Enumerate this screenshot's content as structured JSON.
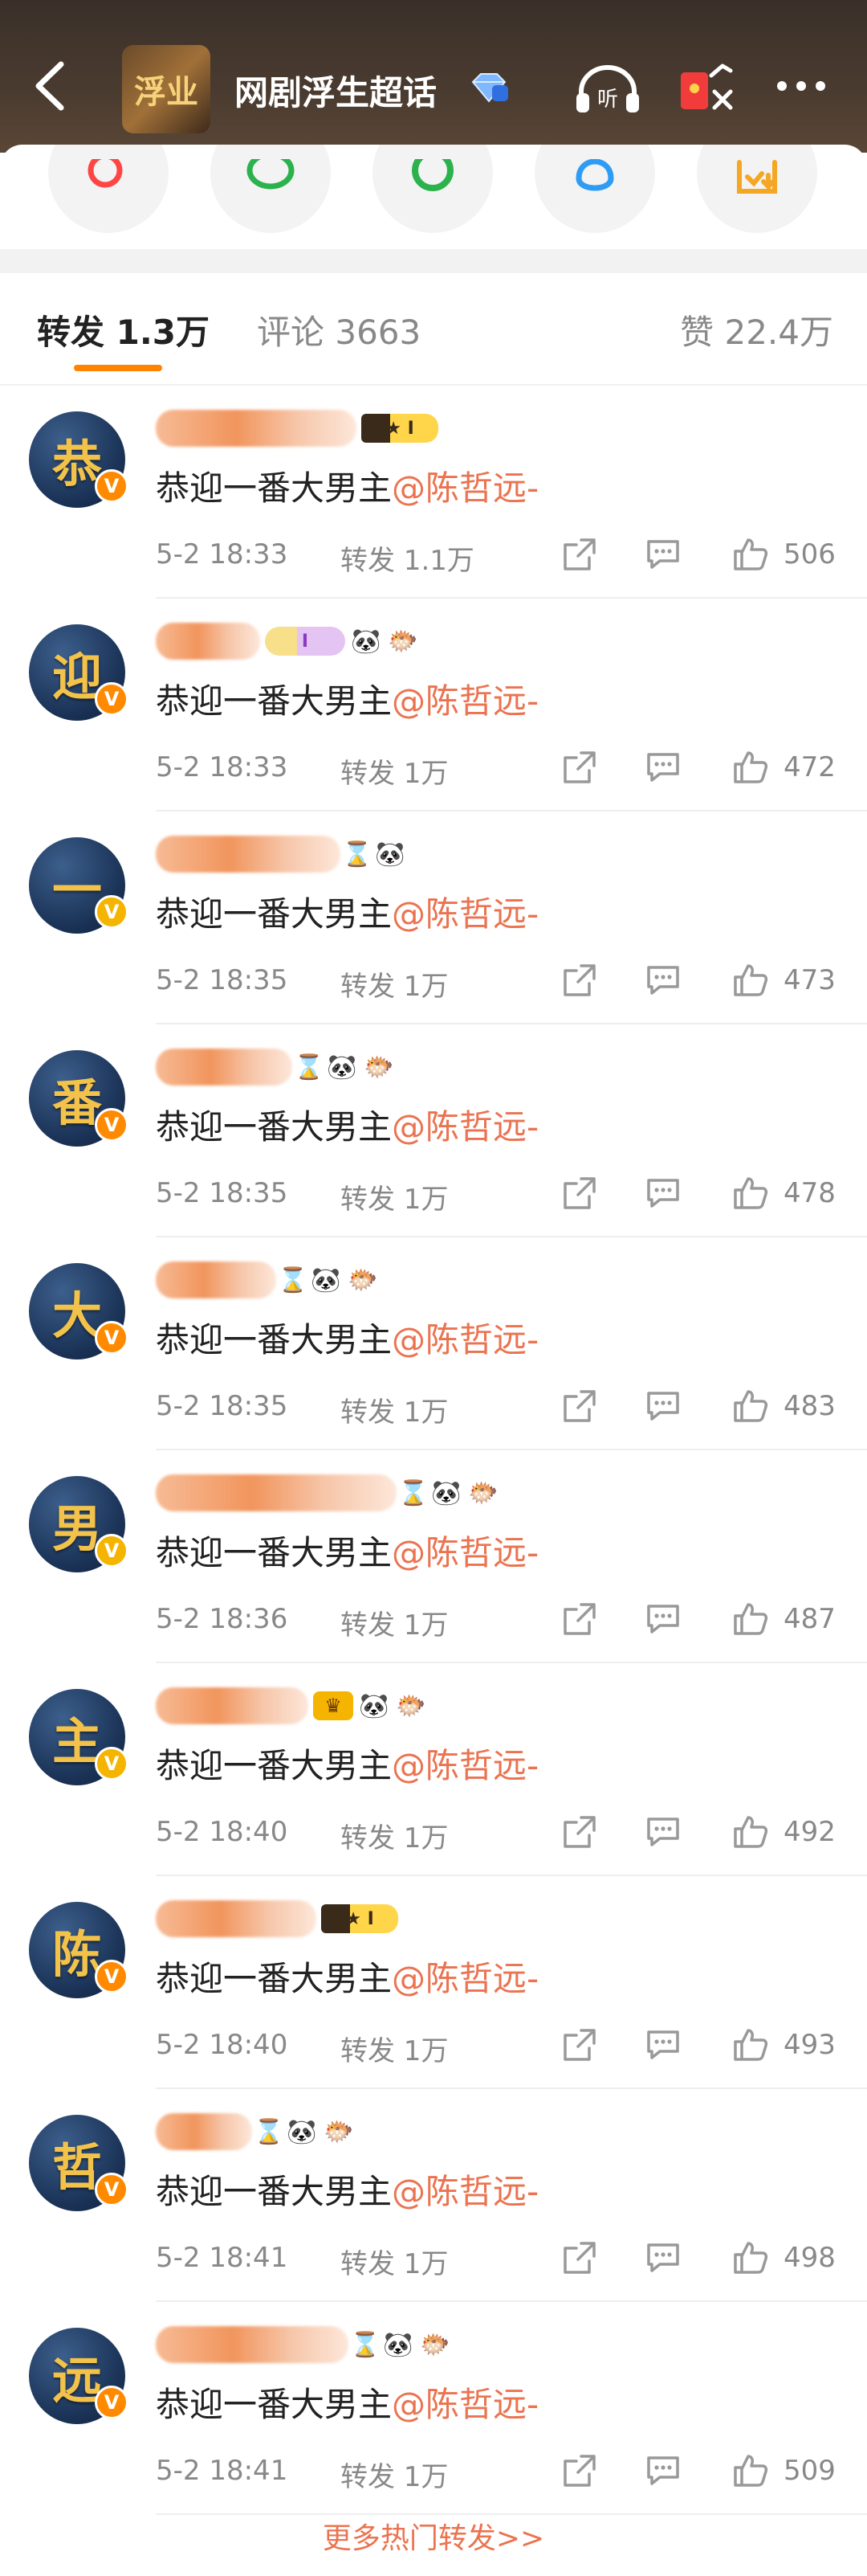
{
  "header": {
    "community_logo_text": "浮业",
    "title": "网剧浮生超话"
  },
  "share_icons": [
    "search-icon",
    "wechat-icon",
    "moments-icon",
    "qq-icon",
    "save-image-icon"
  ],
  "tabs": {
    "repost": "转发 1.3万",
    "comments": "评论 3663",
    "likes": "赞 22.4万"
  },
  "items": [
    {
      "avatar_char": "恭",
      "name_prefix": "边",
      "name_suffix": "",
      "badges": [
        "level"
      ],
      "content": "恭迎一番大男主",
      "mention": "@陈哲远-",
      "time": "5-2 18:33",
      "reposts": "转发 1.1万",
      "likes": "506"
    },
    {
      "avatar_char": "迎",
      "name_prefix": "",
      "name_suffix": "",
      "badges": [
        "purple",
        "panda",
        "fish"
      ],
      "content": "恭迎一番大男主",
      "mention": "@陈哲远-",
      "time": "5-2 18:33",
      "reposts": "转发 1万",
      "likes": "472"
    },
    {
      "avatar_char": "一",
      "name_prefix": "",
      "name_suffix": "",
      "badges": [
        "hourglass",
        "panda"
      ],
      "content": "恭迎一番大男主",
      "mention": "@陈哲远-",
      "time": "5-2 18:35",
      "reposts": "转发 1万",
      "likes": "473"
    },
    {
      "avatar_char": "番",
      "name_prefix": "",
      "name_suffix": "",
      "badges": [
        "hourglass",
        "panda",
        "fish"
      ],
      "content": "恭迎一番大男主",
      "mention": "@陈哲远-",
      "time": "5-2 18:35",
      "reposts": "转发 1万",
      "likes": "478"
    },
    {
      "avatar_char": "大",
      "name_prefix": "",
      "name_suffix": "",
      "badges": [
        "hourglass",
        "panda",
        "fish"
      ],
      "content": "恭迎一番大男主",
      "mention": "@陈哲远-",
      "time": "5-2 18:35",
      "reposts": "转发 1万",
      "likes": "483"
    },
    {
      "avatar_char": "男",
      "name_prefix": "",
      "name_suffix": "",
      "badges": [
        "hourglass",
        "panda",
        "fish"
      ],
      "content": "恭迎一番大男主",
      "mention": "@陈哲远-",
      "time": "5-2 18:36",
      "reposts": "转发 1万",
      "likes": "487"
    },
    {
      "avatar_char": "主",
      "name_prefix": "",
      "name_suffix": "",
      "badges": [
        "crown",
        "panda",
        "fish"
      ],
      "content": "恭迎一番大男主",
      "mention": "@陈哲远-",
      "time": "5-2 18:40",
      "reposts": "转发 1万",
      "likes": "492"
    },
    {
      "avatar_char": "陈",
      "name_prefix": "",
      "name_suffix": "",
      "badges": [
        "level"
      ],
      "content": "恭迎一番大男主",
      "mention": "@陈哲远-",
      "time": "5-2 18:40",
      "reposts": "转发 1万",
      "likes": "493"
    },
    {
      "avatar_char": "哲",
      "name_prefix": "",
      "name_suffix": "",
      "badges": [
        "hourglass",
        "panda",
        "fish"
      ],
      "content": "恭迎一番大男主",
      "mention": "@陈哲远-",
      "time": "5-2 18:41",
      "reposts": "转发 1万",
      "likes": "498"
    },
    {
      "avatar_char": "远",
      "name_prefix": "",
      "name_suffix": "",
      "badges": [
        "hourglass",
        "panda",
        "fish"
      ],
      "content": "恭迎一番大男主",
      "mention": "@陈哲远-",
      "time": "5-2 18:41",
      "reposts": "转发 1万",
      "likes": "509"
    }
  ],
  "footer": {
    "more_link": "更多热门转发>>"
  },
  "colors": {
    "accent": "#ff8200",
    "mention": "#eb7350",
    "meta_text": "#888888",
    "header_bg": "#4a3b30"
  }
}
